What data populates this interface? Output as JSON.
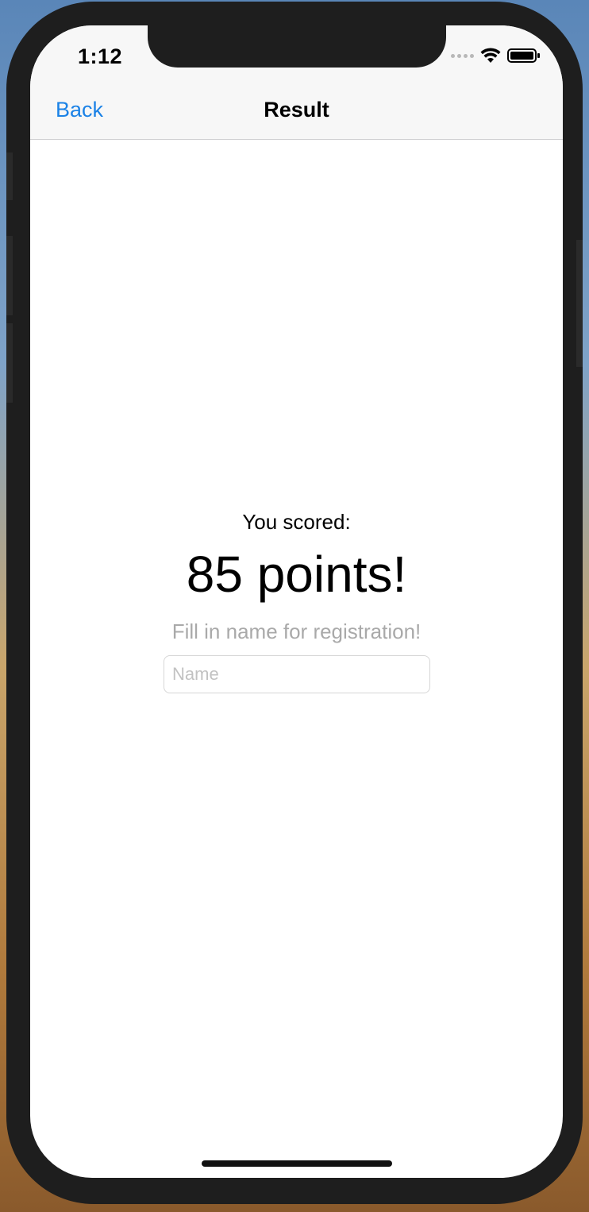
{
  "status_bar": {
    "time": "1:12",
    "icons": [
      "signal-dots-icon",
      "wifi-icon",
      "battery-icon"
    ]
  },
  "nav_bar": {
    "back_label": "Back",
    "title": "Result"
  },
  "result": {
    "scored_label": "You scored:",
    "points_text": "85 points!",
    "hint": "Fill in name for registration!",
    "name_input": {
      "placeholder": "Name",
      "value": ""
    }
  },
  "colors": {
    "accent": "#1b82e6",
    "hint_text": "#a9a9a9",
    "nav_background": "#f7f7f7",
    "frame": "#1e1e1e"
  }
}
